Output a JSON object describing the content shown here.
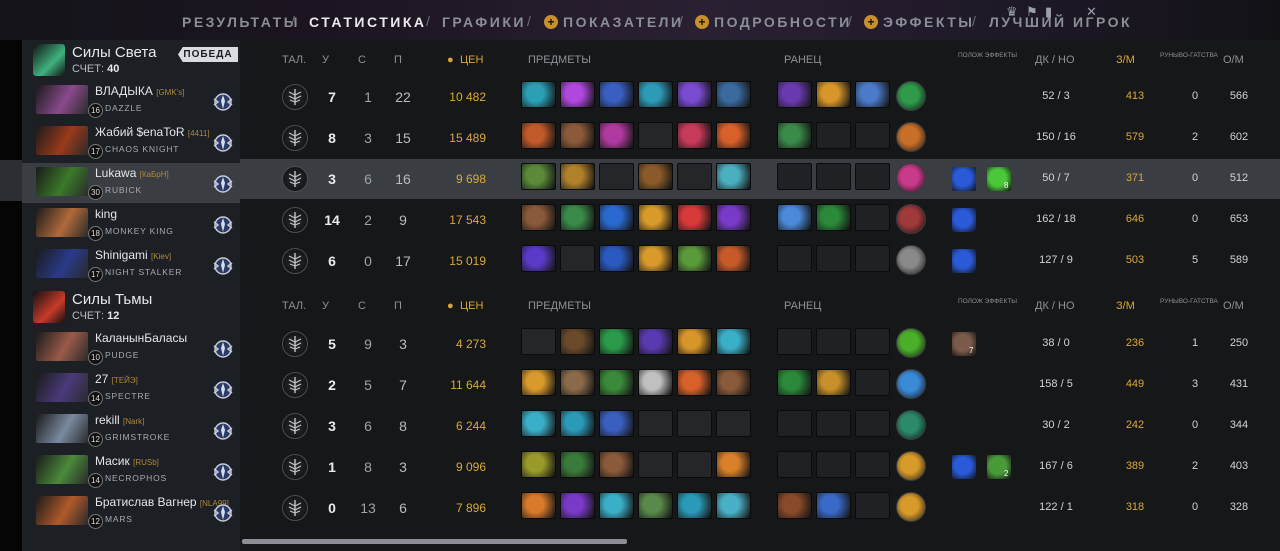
{
  "nav": {
    "items": [
      {
        "label": "РЕЗУЛЬТАТЫ",
        "active": false,
        "plus": false
      },
      {
        "label": "СТАТИСТИКА",
        "active": true,
        "plus": false
      },
      {
        "label": "ГРАФИКИ",
        "active": false,
        "plus": false
      },
      {
        "label": "ПОКАЗАТЕЛИ",
        "active": false,
        "plus": true
      },
      {
        "label": "ПОДРОБНОСТИ",
        "active": false,
        "plus": true
      },
      {
        "label": "ЭФФЕКТЫ",
        "active": false,
        "plus": true
      },
      {
        "label": "ЛУЧШИЙ ИГРОК",
        "active": false,
        "plus": false
      }
    ],
    "separator": "/",
    "plus_symbol": "+"
  },
  "headers": {
    "talents": "ТАЛ.",
    "kills": "У",
    "deaths": "С",
    "assists": "П",
    "networth": "ЦЕН",
    "items": "ПРЕДМЕТЫ",
    "backpack": "РАНЕЦ",
    "buffs": "ПОЛОЖ ЭФФЕКТЫ",
    "lh_dn": "ДК / НО",
    "gpm": "З/М",
    "runes": "РУНЫВО-ГАТСТВА",
    "xpm": "О/М"
  },
  "teams": [
    {
      "name": "Силы Света",
      "score_label": "СЧЕТ:",
      "score": "40",
      "victory": "ПОБЕДА",
      "accent": "#3fb27f",
      "players": [
        {
          "name": "ВЛАДЫКА",
          "tag": "[GMK's]",
          "hero": "DAZZLE",
          "level": "16",
          "k": "7",
          "d": "1",
          "a": "22",
          "networth": "10 482",
          "lh": "52",
          "dn": "3",
          "gpm": "413",
          "runes": "0",
          "xpm": "566",
          "portrait": "#8a4a8c",
          "items": [
            "#2aa0b5",
            "#b048e0",
            "#3a5fc0",
            "#2d9ab8",
            "#7a4ad0",
            "#3a6aa0"
          ],
          "backpack": [
            "#6a3ab0",
            "#d8962a",
            "#4a7ac8"
          ],
          "neutral": "#2e9a4a",
          "buffs": []
        },
        {
          "name": "Жабий $enaToR",
          "tag": "[4411]",
          "hero": "CHAOS KNIGHT",
          "level": "17",
          "k": "8",
          "d": "3",
          "a": "15",
          "networth": "15 489",
          "lh": "150",
          "dn": "16",
          "gpm": "579",
          "runes": "2",
          "xpm": "602",
          "portrait": "#9a3a1a",
          "items": [
            "#c05a2a",
            "#8a5a3a",
            "#b03aa0",
            "",
            "#c83a5a",
            "#d8602a"
          ],
          "backpack": [
            "#3a8a4a",
            "",
            ""
          ],
          "neutral": "#c8702a",
          "buffs": []
        },
        {
          "name": "Lukawa",
          "tag": "[КаБрН]",
          "hero": "RUBICK",
          "level": "30",
          "k": "3",
          "d": "6",
          "a": "16",
          "networth": "9 698",
          "lh": "50",
          "dn": "7",
          "gpm": "371",
          "runes": "0",
          "xpm": "512",
          "portrait": "#3a7a2a",
          "items": [
            "#5a8a3a",
            "#b0802a",
            "",
            "#8a5a2a",
            "",
            "#4ab0c0"
          ],
          "backpack": [
            "",
            "",
            ""
          ],
          "neutral": "#c83a8a",
          "buffs": [
            {
              "color": "#2a5ad8",
              "count": ""
            },
            {
              "color": "#4ac83a",
              "count": "8"
            }
          ]
        },
        {
          "name": "king",
          "tag": "",
          "hero": "MONKEY KING",
          "level": "18",
          "k": "14",
          "d": "2",
          "a": "9",
          "networth": "17 543",
          "lh": "162",
          "dn": "18",
          "gpm": "646",
          "runes": "0",
          "xpm": "653",
          "portrait": "#b06a3a",
          "items": [
            "#8a5a3a",
            "#3a8a4a",
            "#2a6ad0",
            "#d89a2a",
            "#d83a3a",
            "#7a3ac8"
          ],
          "backpack": [
            "#4a8ad8",
            "#2a8a3a",
            ""
          ],
          "neutral": "#a03a3a",
          "buffs": [
            {
              "color": "#2a5ad8",
              "count": ""
            }
          ]
        },
        {
          "name": "Shinigami",
          "tag": "[Kiev]",
          "hero": "NIGHT STALKER",
          "level": "17",
          "k": "6",
          "d": "0",
          "a": "17",
          "networth": "15 019",
          "lh": "127",
          "dn": "9",
          "gpm": "503",
          "runes": "5",
          "xpm": "589",
          "portrait": "#2a3a8a",
          "items": [
            "#5a3ac8",
            "",
            "#2a5ac0",
            "#d89a2a",
            "#5a9a3a",
            "#c85a2a"
          ],
          "backpack": [
            "",
            "",
            ""
          ],
          "neutral": "#8a8a8a",
          "buffs": [
            {
              "color": "#2a5ad8",
              "count": ""
            }
          ]
        }
      ]
    },
    {
      "name": "Силы Тьмы",
      "score_label": "СЧЕТ:",
      "score": "12",
      "victory": "",
      "accent": "#c83a2a",
      "players": [
        {
          "name": "КаланынБаласы",
          "tag": "",
          "hero": "PUDGE",
          "level": "10",
          "k": "5",
          "d": "9",
          "a": "3",
          "networth": "4 273",
          "lh": "38",
          "dn": "0",
          "gpm": "236",
          "runes": "1",
          "xpm": "250",
          "portrait": "#9a5a4a",
          "items": [
            "",
            "#6a4a2a",
            "#2a9a4a",
            "#5a3ab0",
            "#d8962a",
            "#3ab0c8"
          ],
          "backpack": [
            "",
            "",
            ""
          ],
          "neutral": "#4ab02a",
          "buffs": [
            {
              "color": "#7a5a4a",
              "count": "7"
            }
          ]
        },
        {
          "name": "27",
          "tag": "[ТЕЙЭ]",
          "hero": "SPECTRE",
          "level": "14",
          "k": "2",
          "d": "5",
          "a": "7",
          "networth": "11 644",
          "lh": "158",
          "dn": "5",
          "gpm": "449",
          "runes": "3",
          "xpm": "431",
          "portrait": "#4a3a7a",
          "items": [
            "#d89a2a",
            "#8a6a4a",
            "#3a8a3a",
            "#c0c0c0",
            "#d8602a",
            "#8a5a3a"
          ],
          "backpack": [
            "#2a8a3a",
            "#c8902a",
            ""
          ],
          "neutral": "#3a8ad8",
          "buffs": []
        },
        {
          "name": "rekill",
          "tag": "[Nark]",
          "hero": "GRIMSTROKE",
          "level": "12",
          "k": "3",
          "d": "6",
          "a": "8",
          "networth": "6 244",
          "lh": "30",
          "dn": "2",
          "gpm": "242",
          "runes": "0",
          "xpm": "344",
          "portrait": "#7a8aa0",
          "items": [
            "#3ab0c8",
            "#2a9ab8",
            "#3a5fc0",
            "",
            "",
            ""
          ],
          "backpack": [
            "",
            "",
            ""
          ],
          "neutral": "#2a8a6a",
          "buffs": []
        },
        {
          "name": "Масик",
          "tag": "[RUSb]",
          "hero": "NECROPHOS",
          "level": "14",
          "k": "1",
          "d": "8",
          "a": "3",
          "networth": "9 096",
          "lh": "167",
          "dn": "6",
          "gpm": "389",
          "runes": "2",
          "xpm": "403",
          "portrait": "#4a8a3a",
          "items": [
            "#9a9a2a",
            "#3a7a3a",
            "#8a5a3a",
            "",
            "",
            "#d8802a"
          ],
          "backpack": [
            "",
            "",
            ""
          ],
          "neutral": "#d89a2a",
          "buffs": [
            {
              "color": "#2a5ad8",
              "count": ""
            },
            {
              "color": "#4a9a3a",
              "count": "2"
            }
          ]
        },
        {
          "name": "Братислав Вагнер",
          "tag": "[NLA99]",
          "hero": "MARS",
          "level": "12",
          "k": "0",
          "d": "13",
          "a": "6",
          "networth": "7 896",
          "lh": "122",
          "dn": "1",
          "gpm": "318",
          "runes": "0",
          "xpm": "328",
          "portrait": "#b05a2a",
          "items": [
            "#d87a2a",
            "#7a3ac8",
            "#3ab0c8",
            "#5a8a4a",
            "#2a9ab8",
            "#4ab0c8"
          ],
          "backpack": [
            "#8a4a2a",
            "#3a6ac8",
            ""
          ],
          "neutral": "#d89a2a",
          "buffs": []
        }
      ]
    }
  ]
}
